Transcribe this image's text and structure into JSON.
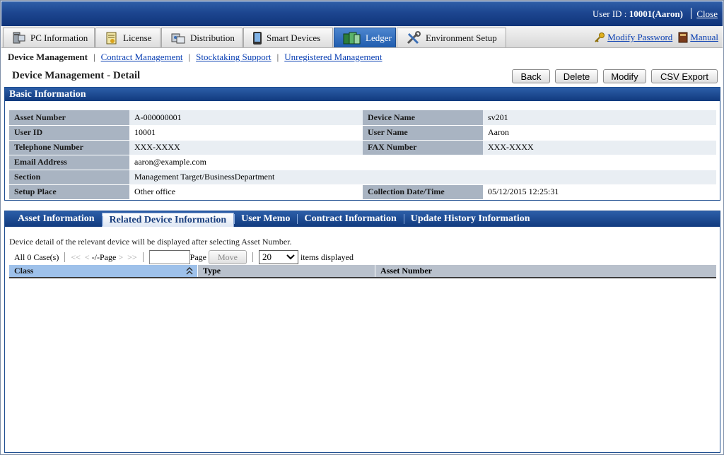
{
  "header": {
    "user_prefix": "User ID : ",
    "user_id": "10001(Aaron)",
    "close": "Close"
  },
  "main_tabs": [
    {
      "label": "PC Information",
      "icon": "pc-icon"
    },
    {
      "label": "License",
      "icon": "license-icon"
    },
    {
      "label": "Distribution",
      "icon": "distribution-icon"
    },
    {
      "label": "Smart Devices",
      "icon": "smartphone-icon"
    },
    {
      "label": "Ledger",
      "icon": "ledger-icon",
      "active": true
    },
    {
      "label": "Environment Setup",
      "icon": "tools-icon"
    }
  ],
  "top_links": {
    "modify_password": "Modify Password",
    "manual": "Manual"
  },
  "subnav": {
    "current": "Device Management",
    "links": [
      "Contract Management",
      "Stocktaking Support",
      "Unregistered Management"
    ]
  },
  "page": {
    "title": "Device Management - Detail",
    "buttons": {
      "back": "Back",
      "delete": "Delete",
      "modify": "Modify",
      "csv": "CSV Export"
    }
  },
  "basic": {
    "title": "Basic Information",
    "asset_number_label": "Asset Number",
    "asset_number": "A-000000001",
    "device_name_label": "Device Name",
    "device_name": "sv201",
    "user_id_label": "User ID",
    "user_id": "10001",
    "user_name_label": "User Name",
    "user_name": "Aaron",
    "telephone_label": "Telephone Number",
    "telephone": "XXX-XXXX",
    "fax_label": "FAX Number",
    "fax": "XXX-XXXX",
    "email_label": "Email Address",
    "email": "aaron@example.com",
    "section_label": "Section",
    "section": "Management Target/BusinessDepartment",
    "setup_place_label": "Setup Place",
    "setup_place": "Other office",
    "collection_label": "Collection Date/Time",
    "collection": "05/12/2015 12:25:31"
  },
  "sub_tabs": [
    "Asset Information",
    "Related Device Information",
    "User Memo",
    "Contract Information",
    "Update History Information"
  ],
  "related": {
    "description": "Device detail of the relevant device will be displayed after selecting Asset Number.",
    "count": "All 0 Case(s)",
    "first": "<<",
    "prev": "<",
    "page_info": "-/-Page",
    "next": ">",
    "last": ">>",
    "page_label": "Page",
    "move": "Move",
    "per_page": "20",
    "items_label": "items displayed",
    "columns": {
      "class": "Class",
      "type": "Type",
      "asset_number": "Asset Number"
    }
  }
}
